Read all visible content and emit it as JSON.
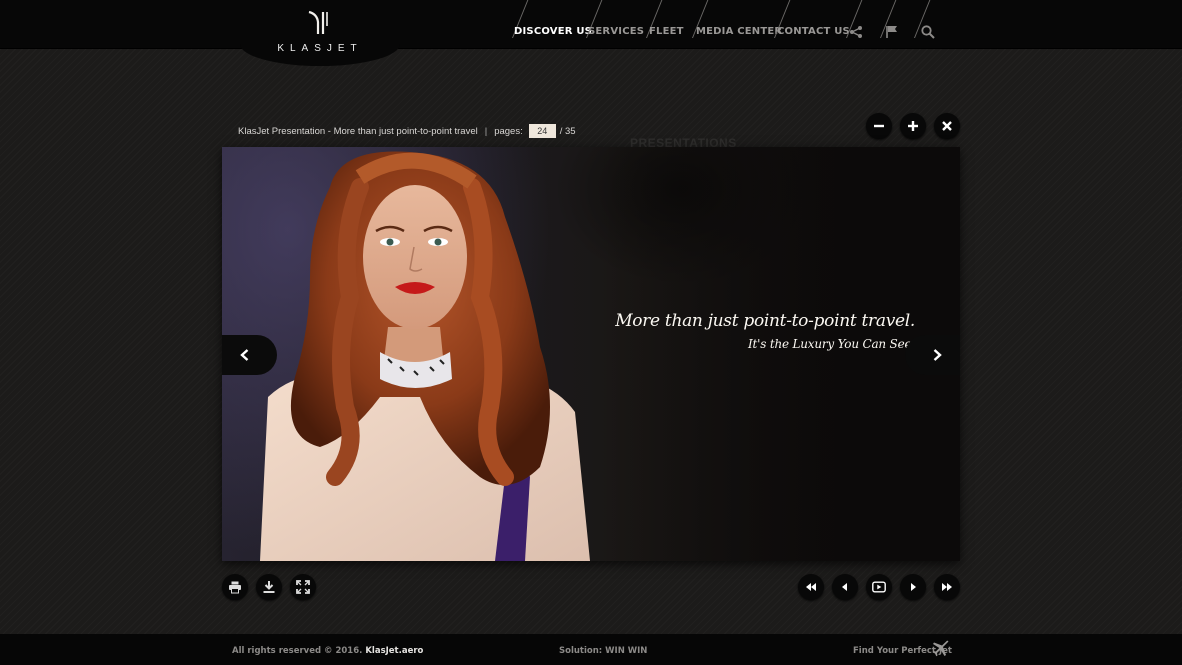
{
  "brand": {
    "name": "KLASJET"
  },
  "nav": {
    "items": [
      {
        "label": "DISCOVER US",
        "active": true
      },
      {
        "label": "SERVICES",
        "active": false
      },
      {
        "label": "FLEET",
        "active": false
      },
      {
        "label": "MEDIA CENTER",
        "active": false
      },
      {
        "label": "CONTACT US",
        "active": false
      }
    ],
    "icons": [
      "share-icon",
      "flag-icon",
      "search-icon"
    ]
  },
  "viewer": {
    "title": "KlasJet Presentation - More than just point-to-point travel",
    "separator": "|",
    "pages_label": "pages:",
    "current_page": "24",
    "total_pages": "/ 35",
    "background_heading": "PRESENTATIONS",
    "slide": {
      "headline": "More than just point-to-point travel.",
      "subline": "It's the Luxury You Can See."
    },
    "top_controls": [
      "zoom-out-icon",
      "zoom-in-icon",
      "close-icon"
    ],
    "left_tools": [
      "print-icon",
      "download-icon",
      "fullscreen-icon"
    ],
    "right_tools": [
      "first-page-icon",
      "previous-page-icon",
      "play-icon",
      "next-page-icon",
      "last-page-icon"
    ]
  },
  "footer": {
    "copyright": "All rights reserved © 2016.",
    "site": "KlasJet.aero",
    "solution": "Solution: WIN WIN",
    "cta": "Find Your Perfect Jet"
  },
  "colors": {
    "header_bg": "#070707",
    "page_bg": "#1c1b1a",
    "active_nav": "#ffffff",
    "inactive_nav": "#9a9896",
    "page_box": "#efe7dc"
  }
}
